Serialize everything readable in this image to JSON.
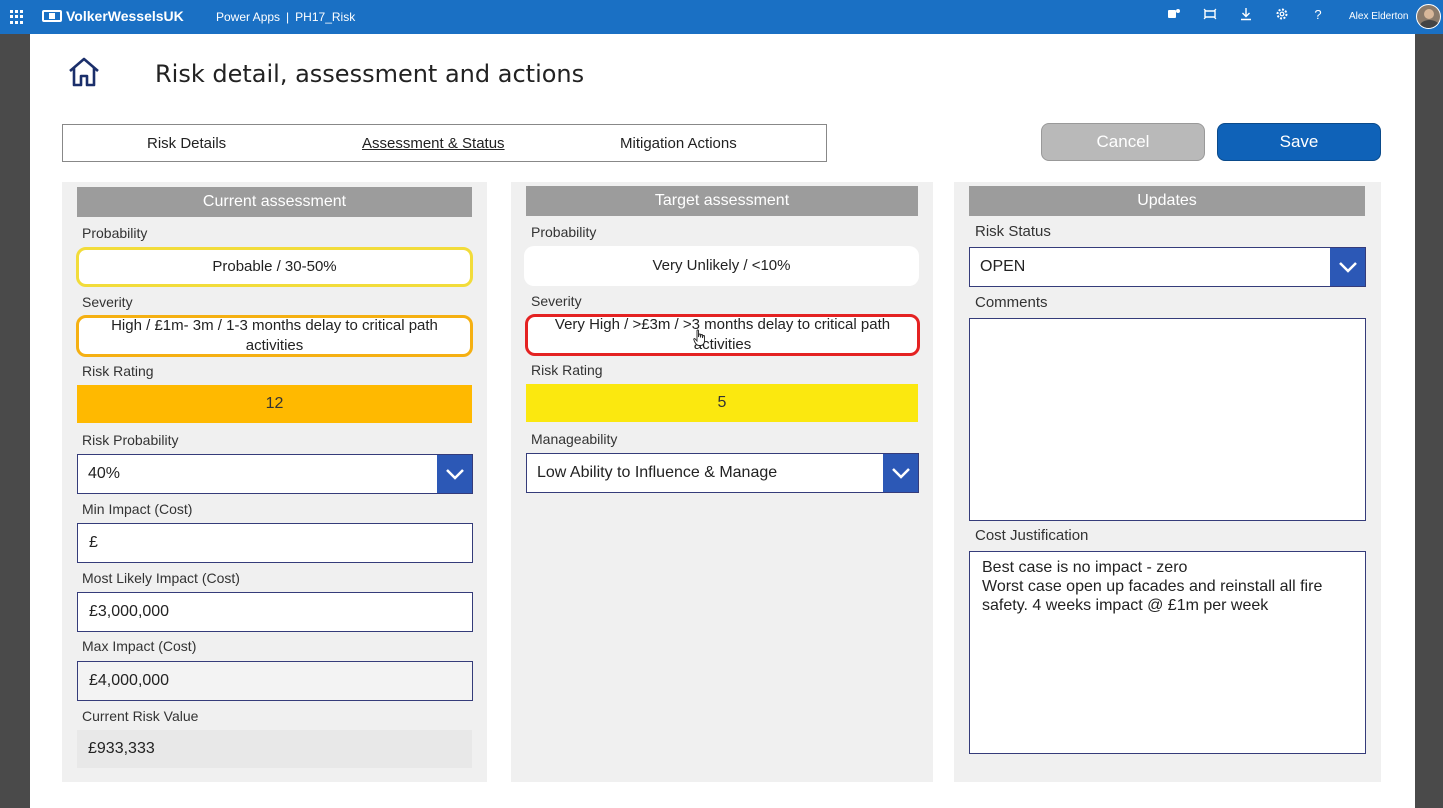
{
  "topbar": {
    "brand": "VolkerWesselsUK",
    "product": "Power Apps",
    "app": "PH17_Risk",
    "user": "Alex Elderton",
    "icons": [
      "teams-icon",
      "fit-icon",
      "download-icon",
      "gear-icon",
      "help-icon"
    ]
  },
  "page": {
    "title": "Risk detail, assessment and actions"
  },
  "tabs": [
    "Risk Details",
    "Assessment & Status",
    "Mitigation Actions"
  ],
  "active_tab": "Assessment & Status",
  "buttons": {
    "cancel": "Cancel",
    "save": "Save"
  },
  "current": {
    "header": "Current assessment",
    "probability_label": "Probability",
    "probability": "Probable / 30-50%",
    "severity_label": "Severity",
    "severity": "High / £1m- 3m / 1-3 months delay to critical path activities",
    "rating_label": "Risk Rating",
    "rating": "12",
    "rating_color": "#ffb900",
    "risk_probability_label": "Risk Probability",
    "risk_probability": "40%",
    "min_impact_label": "Min Impact (Cost)",
    "min_impact": "£",
    "likely_impact_label": "Most Likely Impact (Cost)",
    "likely_impact": "£3,000,000",
    "max_impact_label": "Max Impact (Cost)",
    "max_impact": "£4,000,000",
    "risk_value_label": "Current Risk Value",
    "risk_value": "£933,333"
  },
  "target": {
    "header": "Target assessment",
    "probability_label": "Probability",
    "probability": "Very Unlikely / <10%",
    "severity_label": "Severity",
    "severity": "Very High / >£3m / >3 months delay to critical path activities",
    "rating_label": "Risk Rating",
    "rating": "5",
    "rating_color": "#fbe80f",
    "manageability_label": "Manageability",
    "manageability": "Low Ability to Influence & Manage"
  },
  "updates": {
    "header": "Updates",
    "status_label": "Risk Status",
    "status": "OPEN",
    "comments_label": "Comments",
    "comments": "",
    "cost_label": "Cost Justification",
    "cost_justification": "Best case is no impact - zero\nWorst case open up facades and reinstall all fire safety. 4 weeks impact @ £1m per week"
  },
  "colors": {
    "topbar": "#1a70c4",
    "save": "#0f62b8",
    "header_bg": "#9c9c9c",
    "dropdown_chevron": "#2c58b6",
    "border": "#353c7a"
  }
}
